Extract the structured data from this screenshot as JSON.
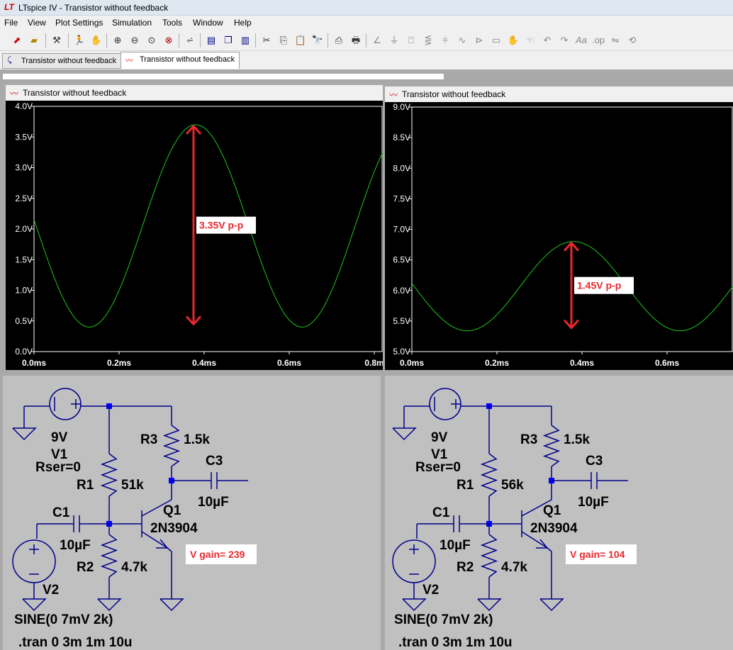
{
  "window": {
    "title": "LTspice IV - Transistor without feedback",
    "app_icon_text": "LT"
  },
  "menu": {
    "items": [
      "File",
      "View",
      "Plot Settings",
      "Simulation",
      "Tools",
      "Window",
      "Help"
    ]
  },
  "toolbar": {
    "icons": [
      "open-schematic-icon",
      "open-file-icon",
      "control-panel-icon",
      "run-icon",
      "halt-icon",
      "zoom-in-icon",
      "zoom-out-icon",
      "zoom-fit-icon",
      "zoom-cancel-icon",
      "autorange-icon",
      "tile-horizontal-icon",
      "cascade-icon",
      "tile-vertical-icon",
      "cut-icon",
      "copy-icon",
      "paste-icon",
      "find-icon",
      "print-preview-icon",
      "print-icon",
      "wire-icon",
      "ground-icon",
      "label-icon",
      "resistor-icon",
      "capacitor-icon",
      "inductor-icon",
      "diode-icon",
      "component-icon",
      "move-icon",
      "drag-icon",
      "undo-icon",
      "redo-icon",
      "text-icon",
      "spice-directive-icon",
      "mirror-icon",
      "rotate-icon"
    ]
  },
  "tabs": [
    {
      "label": "Transistor without feedback",
      "kind": "schematic"
    },
    {
      "label": "Transistor without feedback",
      "kind": "waveform"
    }
  ],
  "colors": {
    "trace": "#1ec81e",
    "annotation": "#e8282c",
    "wire": "#00008b",
    "plot_bg": "#000000",
    "axis_text": "#ffffff"
  },
  "plots": [
    {
      "title": "Transistor without feedback",
      "annotation": "3.35V p-p",
      "chart_data": {
        "type": "line",
        "y_tick_labels": [
          "0.0V",
          "0.5V",
          "1.0V",
          "1.5V",
          "2.0V",
          "2.5V",
          "3.0V",
          "3.5V",
          "4.0V"
        ],
        "x_tick_labels": [
          "0.0ms",
          "0.2ms",
          "0.4ms",
          "0.6ms",
          "0.8m"
        ],
        "xlim": [
          0,
          0.82
        ],
        "ylim": [
          0,
          4.0
        ],
        "series": [
          {
            "center": 2.05,
            "amplitude": 1.65,
            "freq_hz": 2000,
            "phase_ms": 0.005
          }
        ]
      }
    },
    {
      "title": "Transistor without feedback",
      "annotation": "1.45V p-p",
      "chart_data": {
        "type": "line",
        "y_tick_labels": [
          "5.0V",
          "5.5V",
          "6.0V",
          "6.5V",
          "7.0V",
          "7.5V",
          "8.0V",
          "8.5V",
          "9.0V"
        ],
        "x_tick_labels": [
          "0.0ms",
          "0.2ms",
          "0.4ms",
          "0.6ms"
        ],
        "xlim": [
          0,
          0.755
        ],
        "ylim": [
          5.0,
          9.0
        ],
        "series": [
          {
            "center": 6.07,
            "amplitude": 0.73,
            "freq_hz": 2000,
            "phase_ms": 0.005
          }
        ]
      }
    }
  ],
  "schematics": [
    {
      "v1": {
        "value": "9V",
        "name": "V1",
        "rser": "Rser=0"
      },
      "r1": {
        "name": "R1",
        "value": "51k"
      },
      "r2": {
        "name": "R2",
        "value": "4.7k"
      },
      "r3": {
        "name": "R3",
        "value": "1.5k"
      },
      "c1": {
        "name": "C1",
        "value": "10µF"
      },
      "c3": {
        "name": "C3",
        "value": "10µF"
      },
      "q1": {
        "name": "Q1",
        "model": "2N3904"
      },
      "v2": {
        "name": "V2",
        "value": "SINE(0 7mV 2k)"
      },
      "directive": ".tran 0 3m 1m 10u",
      "gain": "V gain= 239"
    },
    {
      "v1": {
        "value": "9V",
        "name": "V1",
        "rser": "Rser=0"
      },
      "r1": {
        "name": "R1",
        "value": "56k"
      },
      "r2": {
        "name": "R2",
        "value": "4.7k"
      },
      "r3": {
        "name": "R3",
        "value": "1.5k"
      },
      "c1": {
        "name": "C1",
        "value": "10µF"
      },
      "c3": {
        "name": "C3",
        "value": "10µF"
      },
      "q1": {
        "name": "Q1",
        "model": "2N3904"
      },
      "v2": {
        "name": "V2",
        "value": "SINE(0 7mV 2k)"
      },
      "directive": ".tran 0 3m 1m 10u",
      "gain": "V gain= 104"
    }
  ]
}
